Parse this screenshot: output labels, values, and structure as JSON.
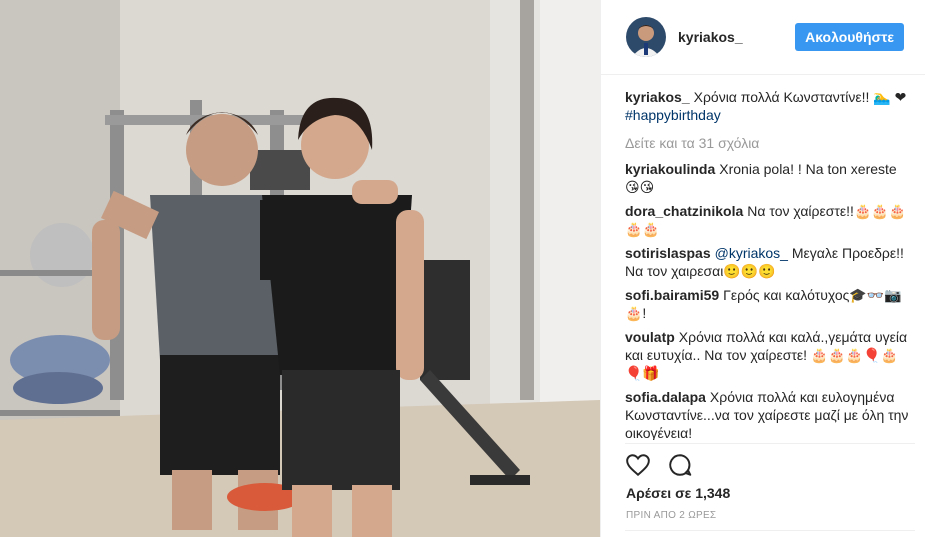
{
  "header": {
    "username": "kyriakos_",
    "follow_label": "Ακολουθήστε"
  },
  "caption": {
    "user": "kyriakos_",
    "text": "Χρόνια πολλά Κωνσταντίνε!! 🏊‍♂️ ❤",
    "hashtag": "#happybirthday"
  },
  "view_all_label": "Δείτε και τα 31 σχόλια",
  "comments": [
    {
      "user": "kyriakoulinda",
      "text": "Xronia pola! ! Na ton xereste 😘😘"
    },
    {
      "user": "dora_chatzinikola",
      "text": "Να τον χαίρεστε!!🎂🎂🎂🎂🎂"
    },
    {
      "user": "sotirislaspas",
      "mention": "@kyriakos_",
      "text": " Μεγαλε Προεδρε!!Να τον χαιρεσαι🙂🙂🙂"
    },
    {
      "user": "sofi.bairami59",
      "text": "Γερός και καλότυχος🎓👓📷🎂!"
    },
    {
      "user": "voulatp",
      "text": "Χρόνια πολλά και καλά.,γεμάτα υγεία και ευτυχία.. Να τον χαίρεστε! 🎂🎂🎂🎈🎂🎈🎁"
    },
    {
      "user": "sofia.dalapa",
      "text": "Χρόνια πολλά και ευλογημένα Κωνσταντίνε...να τον χαίρεστε μαζί με όλη την οικογένεια!"
    }
  ],
  "likes_label": "Αρέσει σε 1,348",
  "time_label": "ΠΡΙΝ ΑΠΟ 2 ΩΡΕΣ",
  "icons": {
    "like": "heart-icon",
    "comment": "comment-icon"
  },
  "colors": {
    "follow_button": "#3897f0",
    "hashtag": "#003569",
    "muted": "#999999"
  }
}
